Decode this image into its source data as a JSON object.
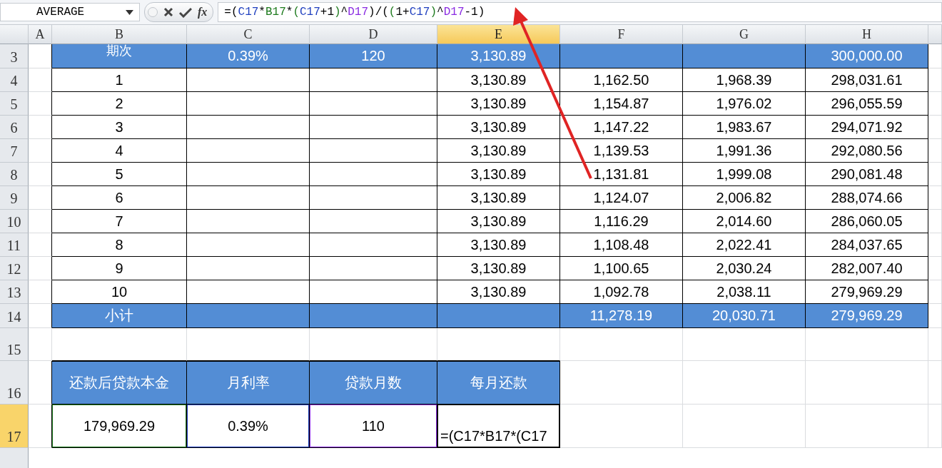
{
  "name_box": "AVERAGE",
  "fx_label": "fx",
  "formula": [
    {
      "text": "=("
    },
    {
      "text": "C17",
      "color": "#1f3fbf"
    },
    {
      "text": "*"
    },
    {
      "text": "B17",
      "color": "#1e7b1e"
    },
    {
      "text": "*"
    },
    {
      "text": "(",
      "color": "#1e7b1e"
    },
    {
      "text": "C17",
      "color": "#1f3fbf"
    },
    {
      "text": "+1"
    },
    {
      "text": ")",
      "color": "#1e7b1e"
    },
    {
      "text": "^"
    },
    {
      "text": "D17",
      "color": "#8a2be2"
    },
    {
      "text": ")/("
    },
    {
      "text": "(",
      "color": "#1e7b1e"
    },
    {
      "text": "1+"
    },
    {
      "text": "C17",
      "color": "#1f3fbf"
    },
    {
      "text": ")",
      "color": "#1e7b1e"
    },
    {
      "text": "^"
    },
    {
      "text": "D17",
      "color": "#8a2be2"
    },
    {
      "text": "-1)"
    }
  ],
  "columns": [
    {
      "label": "A",
      "selected": false
    },
    {
      "label": "B",
      "selected": false
    },
    {
      "label": "C",
      "selected": false
    },
    {
      "label": "D",
      "selected": false
    },
    {
      "label": "E",
      "selected": true
    },
    {
      "label": "F",
      "selected": false
    },
    {
      "label": "G",
      "selected": false
    },
    {
      "label": "H",
      "selected": false
    }
  ],
  "rows": [
    {
      "number": "3",
      "selected": false,
      "kind": "band",
      "cells": [
        "期次",
        "0.39%",
        "120",
        "3,130.89",
        null,
        null,
        "300,000.00"
      ]
    },
    {
      "number": "4",
      "selected": false,
      "kind": "data",
      "cells": [
        "1",
        null,
        null,
        "3,130.89",
        "1,162.50",
        "1,968.39",
        "298,031.61"
      ]
    },
    {
      "number": "5",
      "selected": false,
      "kind": "data",
      "cells": [
        "2",
        null,
        null,
        "3,130.89",
        "1,154.87",
        "1,976.02",
        "296,055.59"
      ]
    },
    {
      "number": "6",
      "selected": false,
      "kind": "data",
      "cells": [
        "3",
        null,
        null,
        "3,130.89",
        "1,147.22",
        "1,983.67",
        "294,071.92"
      ]
    },
    {
      "number": "7",
      "selected": false,
      "kind": "data",
      "cells": [
        "4",
        null,
        null,
        "3,130.89",
        "1,139.53",
        "1,991.36",
        "292,080.56"
      ]
    },
    {
      "number": "8",
      "selected": false,
      "kind": "data",
      "cells": [
        "5",
        null,
        null,
        "3,130.89",
        "1,131.81",
        "1,999.08",
        "290,081.48"
      ]
    },
    {
      "number": "9",
      "selected": false,
      "kind": "data",
      "cells": [
        "6",
        null,
        null,
        "3,130.89",
        "1,124.07",
        "2,006.82",
        "288,074.66"
      ]
    },
    {
      "number": "10",
      "selected": false,
      "kind": "data",
      "cells": [
        "7",
        null,
        null,
        "3,130.89",
        "1,116.29",
        "2,014.60",
        "286,060.05"
      ]
    },
    {
      "number": "11",
      "selected": false,
      "kind": "data",
      "cells": [
        "8",
        null,
        null,
        "3,130.89",
        "1,108.48",
        "2,022.41",
        "284,037.65"
      ]
    },
    {
      "number": "12",
      "selected": false,
      "kind": "data",
      "cells": [
        "9",
        null,
        null,
        "3,130.89",
        "1,100.65",
        "2,030.24",
        "282,007.40"
      ]
    },
    {
      "number": "13",
      "selected": false,
      "kind": "data",
      "cells": [
        "10",
        null,
        null,
        "3,130.89",
        "1,092.78",
        "2,038.11",
        "279,969.29"
      ]
    },
    {
      "number": "14",
      "selected": false,
      "kind": "band",
      "cells": [
        "小计",
        null,
        null,
        null,
        "11,278.19",
        "20,030.71",
        "279,969.29"
      ]
    },
    {
      "number": "15",
      "selected": false,
      "kind": "blank",
      "cells": []
    },
    {
      "number": "16",
      "selected": false,
      "kind": "header",
      "cells": [
        "还款后贷款本金",
        "月利率",
        "贷款月数",
        "每月还款"
      ]
    },
    {
      "number": "17",
      "selected": true,
      "kind": "input",
      "cells": [
        {
          "text": "179,969.29",
          "color": "#1e7b1e"
        },
        {
          "text": "0.39%",
          "color": "#1f3fbf"
        },
        {
          "text": "110",
          "color": "#8a2be2"
        },
        {
          "text": "=(C17*B17*(C17",
          "color": "#000000"
        }
      ]
    }
  ]
}
